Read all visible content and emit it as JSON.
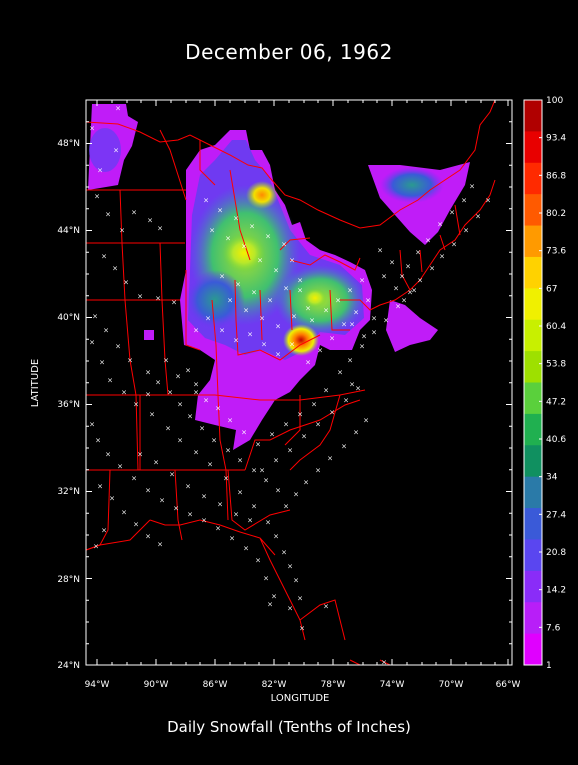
{
  "title": "December 06, 1962",
  "subtitle": "Daily Snowfall (Tenths of Inches)",
  "map": {
    "x_axis_label": "LONGITUDE",
    "y_axis_label": "LATITUDE",
    "lon_ticks": [
      "94°W",
      "90°W",
      "86°W",
      "82°W",
      "78°W",
      "74°W",
      "70°W",
      "66°W"
    ],
    "lat_ticks": [
      "48°N",
      "44°N",
      "40°N",
      "36°N",
      "32°N",
      "28°N",
      "24°N"
    ],
    "lon_range": [
      -95,
      -66
    ],
    "lat_range": [
      24,
      50
    ],
    "border_color": "#ff0000",
    "station_marker": "×",
    "station_color": "#ffffff"
  },
  "legend": {
    "labels": [
      "100",
      "93.4",
      "86.8",
      "80.2",
      "73.6",
      "67",
      "60.4",
      "53.8",
      "47.2",
      "40.6",
      "34",
      "27.4",
      "20.8",
      "14.2",
      "7.6",
      "1"
    ],
    "colors": [
      "#b00000",
      "#e80000",
      "#ff2a00",
      "#ff5a00",
      "#ff9a00",
      "#ffd200",
      "#f0f000",
      "#c8f000",
      "#9ee000",
      "#5ad03c",
      "#20b050",
      "#109060",
      "#2a7aa8",
      "#3a5ad8",
      "#5a46f0",
      "#8a2cf8",
      "#b81ef8",
      "#e000ff"
    ]
  },
  "chart_data": {
    "type": "heatmap",
    "title": "December 06, 1962",
    "subtitle": "Daily Snowfall (Tenths of Inches)",
    "xlabel": "LONGITUDE",
    "ylabel": "LATITUDE",
    "xlim": [
      -95,
      -66
    ],
    "ylim": [
      24,
      50
    ],
    "value_range": [
      1,
      100
    ],
    "units": "tenths of inches",
    "maxima": [
      {
        "lon": -79.3,
        "lat": 38.8,
        "value": 95
      },
      {
        "lon": -82.7,
        "lat": 45.5,
        "value": 65
      },
      {
        "lon": -84.5,
        "lat": 42.8,
        "value": 60
      }
    ]
  }
}
